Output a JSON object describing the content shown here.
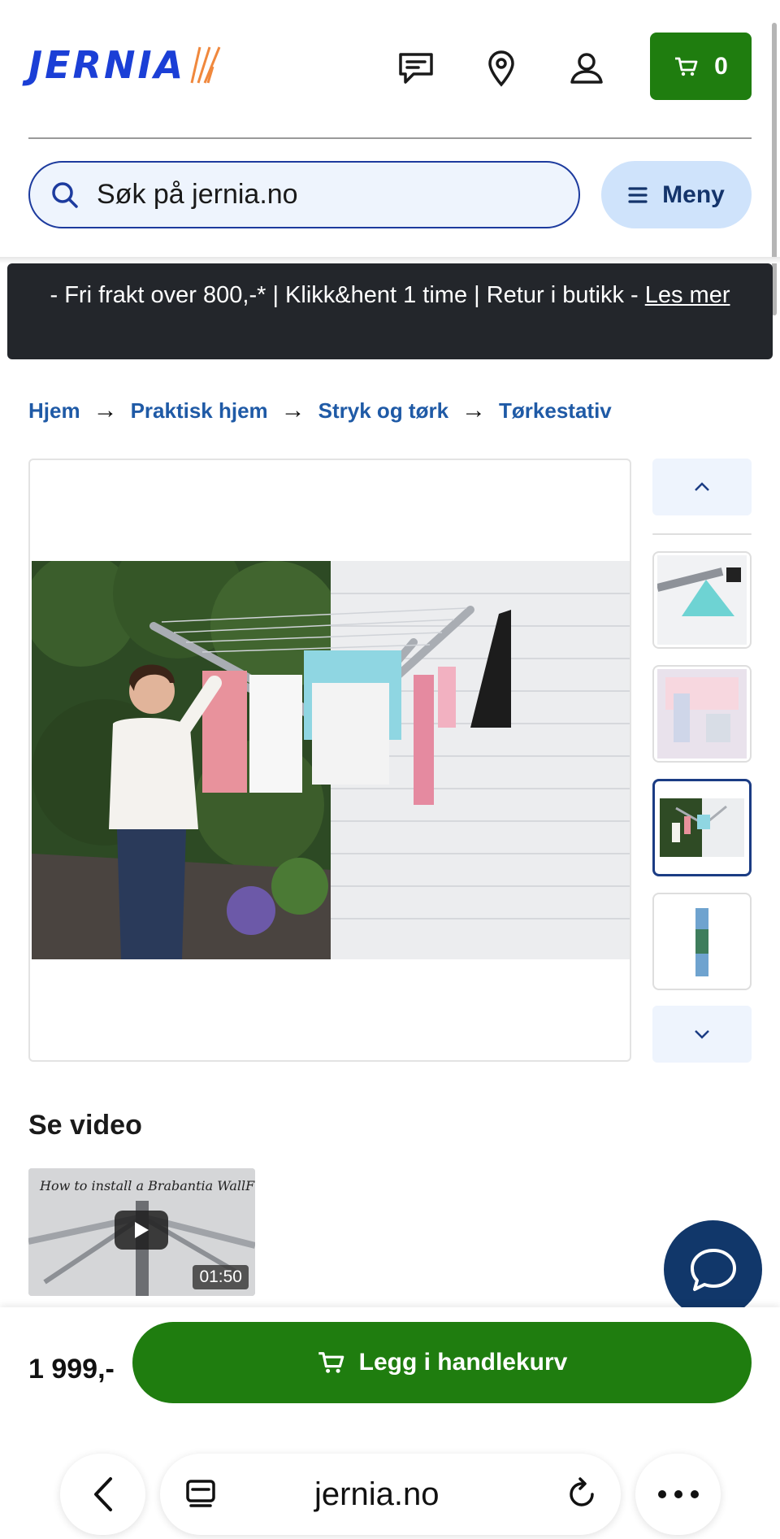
{
  "header": {
    "logo_text": "JERNIA",
    "cart_count": "0",
    "search_placeholder": "Søk på jernia.no",
    "menu_label": "Meny",
    "brand_blue": "#1b3fd6",
    "accent_green": "#1f7d0f"
  },
  "banner": {
    "text": "- Fri frakt over 800,-* | Klikk&hent 1 time | Retur i butikk - ",
    "link": "Les mer"
  },
  "breadcrumb": {
    "items": [
      "Hjem",
      "Praktisk hjem",
      "Stryk og tørk",
      "Tørkestativ"
    ]
  },
  "video": {
    "section_title": "Se video",
    "caption": "How to install a Brabantia WallFix dryer.",
    "duration": "01:50"
  },
  "buy_bar": {
    "price": "1 999,-",
    "add_to_cart_label": "Legg i handlekurv"
  },
  "browser": {
    "url": "jernia.no"
  }
}
